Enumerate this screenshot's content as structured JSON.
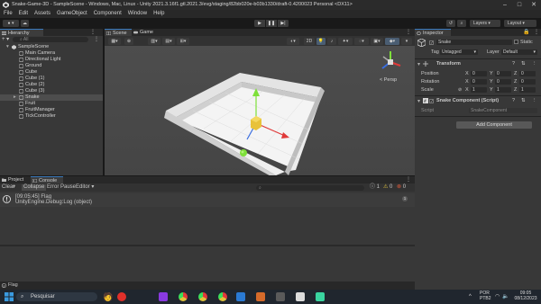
{
  "window": {
    "title": "Snake-Game-3D - SampleScene - Windows, Mac, Linux - Unity 2021.3.16f1.gtl.2021.3/evg/staging/82bb020e-b03b1330/draft-0.4200023 Personal <DX11>"
  },
  "menu": [
    "File",
    "Edit",
    "Assets",
    "GameObject",
    "Component",
    "Window",
    "Help"
  ],
  "toolbar": {
    "play": "▶",
    "pause": "❚❚",
    "step": "▶|",
    "layers": "Layers",
    "layout": "Layout"
  },
  "hierarchy": {
    "tab": "Hierarchy",
    "search_placeholder": "All",
    "root": "SampleScene",
    "items": [
      "Main Camera",
      "Directional Light",
      "Ground",
      "Cube",
      "Cube (1)",
      "Cube (2)",
      "Cube (3)",
      "Snake",
      "Fruit",
      "FruitManager",
      "TickController"
    ]
  },
  "scene": {
    "tabs": [
      "Scene",
      "Game"
    ],
    "mode_2d": "2D",
    "persp": "< Persp"
  },
  "inspector": {
    "tab": "Inspector",
    "object_name": "Snake",
    "static_label": "Static",
    "tag_label": "Tag",
    "tag_value": "Untagged",
    "layer_label": "Layer",
    "layer_value": "Default",
    "transform_title": "Transform",
    "position_label": "Position",
    "rotation_label": "Rotation",
    "scale_label": "Scale",
    "position": [
      "0",
      "0",
      "0"
    ],
    "rotation": [
      "0",
      "0",
      "0"
    ],
    "scale": [
      "1",
      "1",
      "1"
    ],
    "axis": [
      "X",
      "Y",
      "Z"
    ],
    "component_title": "Snake Component (Script)",
    "script_label": "Script",
    "script_value": "SnakeComponent",
    "add_component": "Add Component"
  },
  "console": {
    "tabs": [
      "Project",
      "Console"
    ],
    "buttons": [
      "Clear",
      "Collapse",
      "Error Pause",
      "Editor"
    ],
    "counts": [
      "1",
      "0",
      "0"
    ],
    "entry_line1": "[09:05:45] Flag",
    "entry_line2": "UnityEngine.Debug:Log (object)"
  },
  "status": {
    "text": "Flag"
  },
  "taskbar": {
    "search": "Pesquisar",
    "lang": "POR",
    "lang2": "PTB2",
    "time": "09:05",
    "date": "08/12/2023"
  },
  "colors": {
    "selection": "#4d4d4d",
    "accent": "#3a79bb",
    "gizmo_green": "#7ee03a",
    "gizmo_red": "#e03a3a",
    "snake_yellow": "#e8c23a"
  }
}
